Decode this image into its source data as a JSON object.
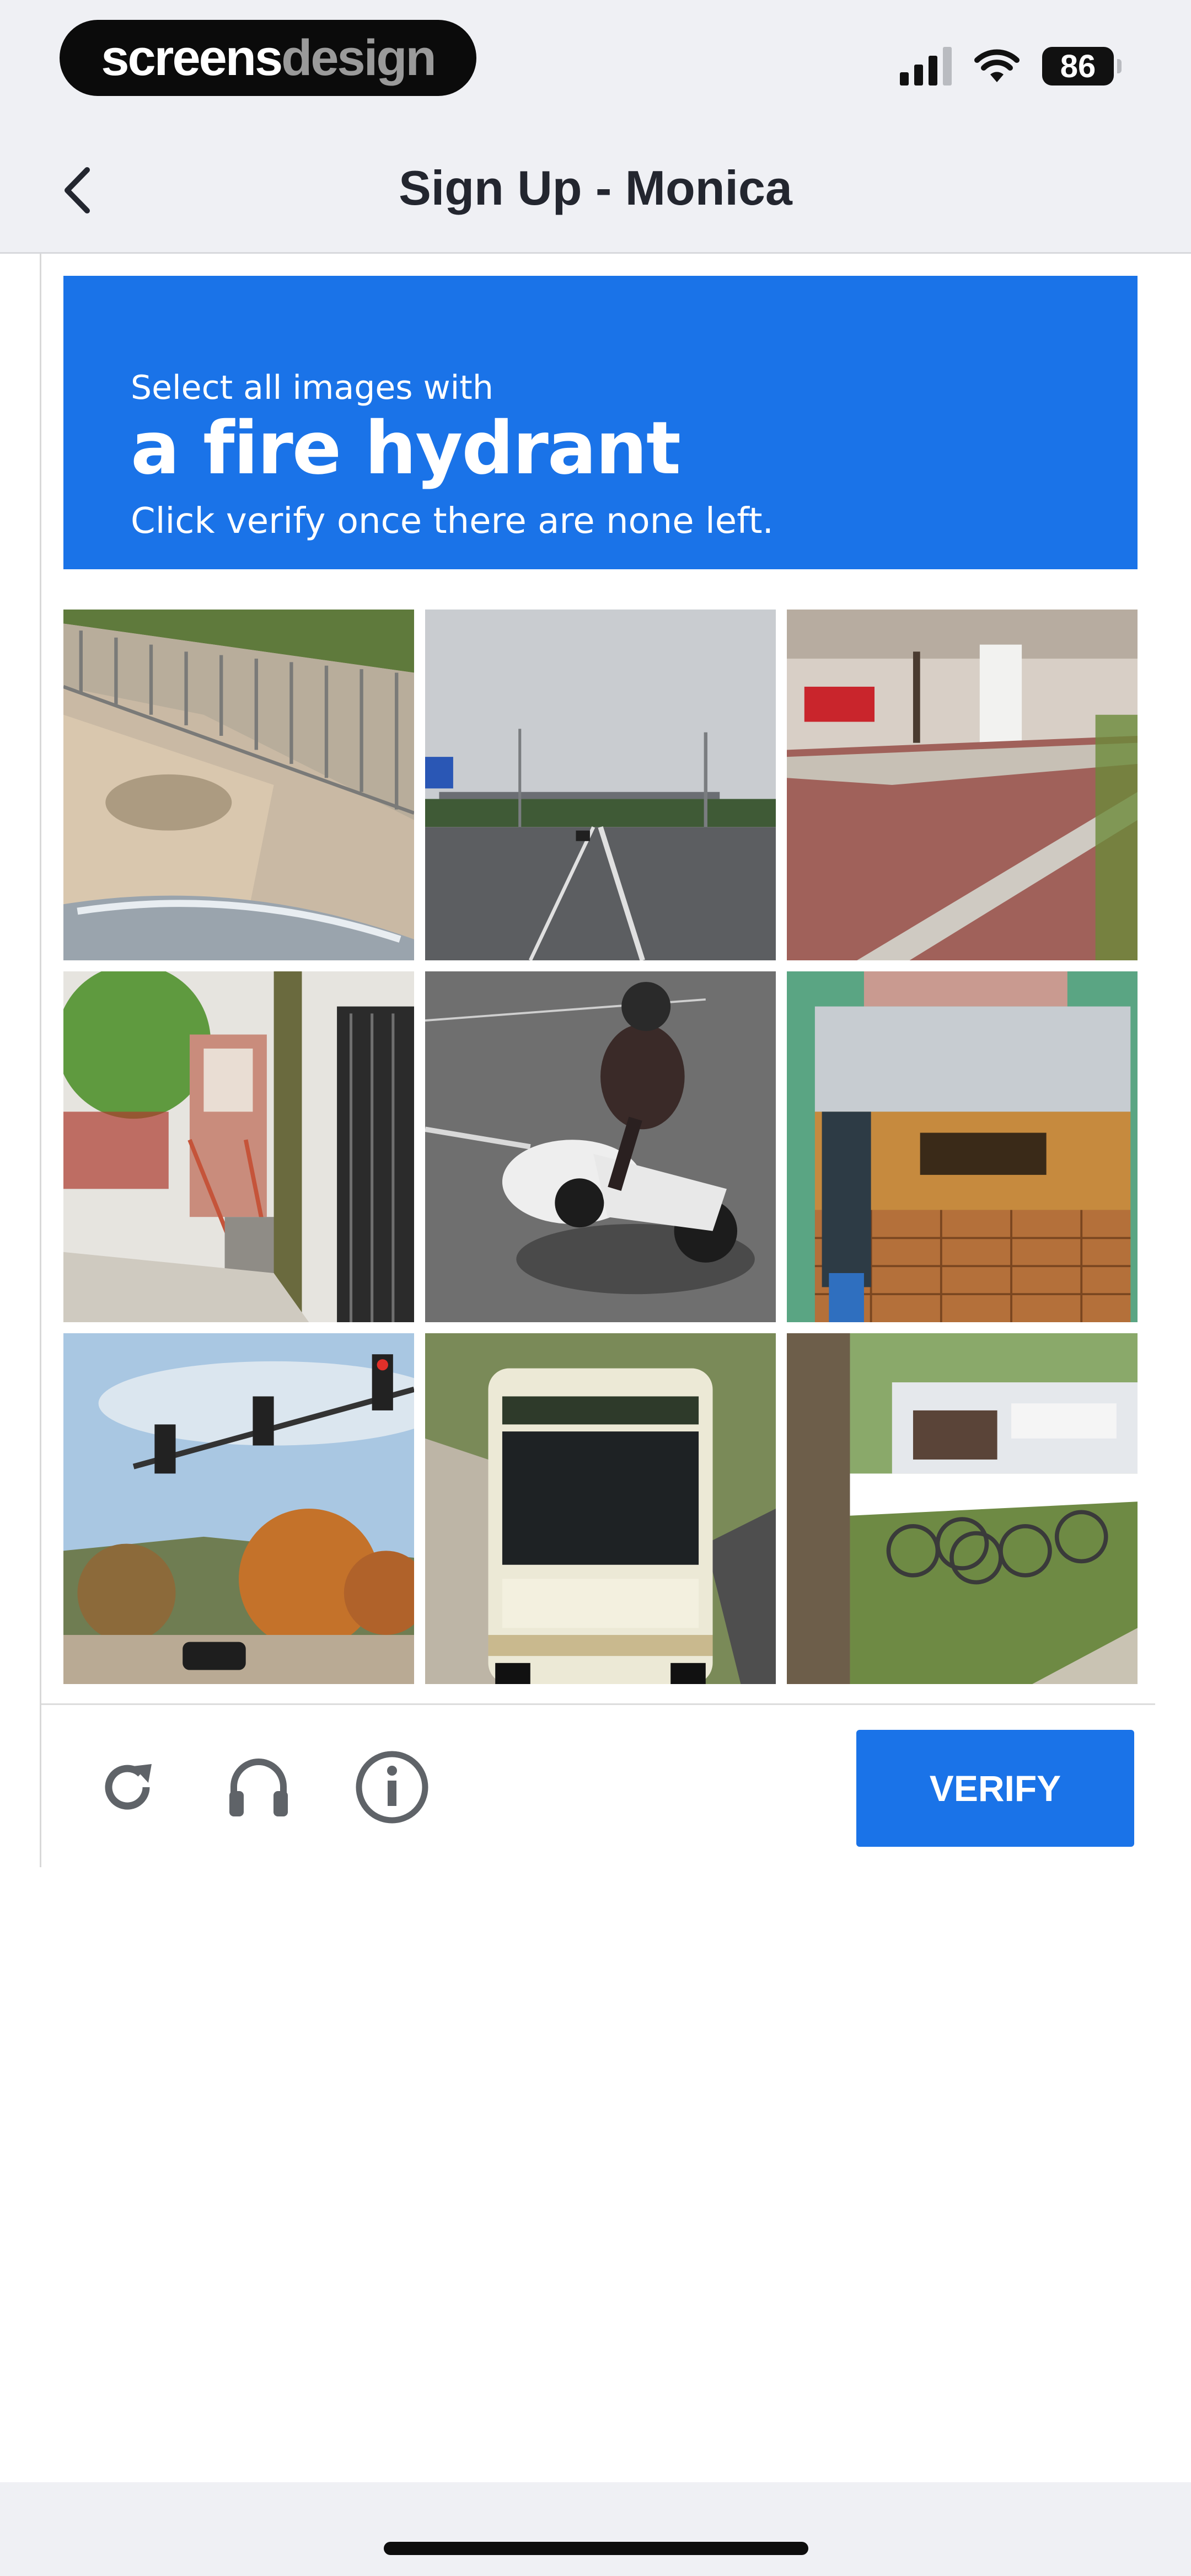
{
  "status_bar": {
    "brand_part1": "screens",
    "brand_part2": "design",
    "battery": "86",
    "icons": [
      "signal-icon",
      "wifi-icon",
      "battery-icon"
    ]
  },
  "nav": {
    "title": "Sign Up - Monica",
    "back_icon": "chevron-left-icon"
  },
  "captcha": {
    "instruction_line1": "Select all images with",
    "target_object": "a fire hydrant",
    "instruction_line3": "Click verify once there are none left.",
    "tiles": [
      {
        "subject": "sidewalk with fence"
      },
      {
        "subject": "highway with overhead sign"
      },
      {
        "subject": "brick plaza and building"
      },
      {
        "subject": "house entrance with stairs"
      },
      {
        "subject": "motorcycle rider"
      },
      {
        "subject": "stacked crates"
      },
      {
        "subject": "traffic lights"
      },
      {
        "subject": "city bus"
      },
      {
        "subject": "bicycles by marina"
      }
    ],
    "footer_icons": [
      "reload-icon",
      "headphones-icon",
      "info-icon"
    ],
    "verify_label": "VERIFY"
  },
  "colors": {
    "accent": "#1a73e8",
    "chrome_bg": "#eff0f4",
    "title_text": "#23262f"
  }
}
